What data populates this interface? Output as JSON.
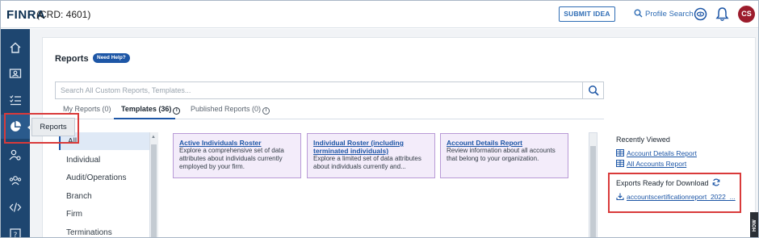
{
  "header": {
    "logo": "FINRA",
    "crd": "(CRD: 4601)",
    "submit_idea": "SUBMIT IDEA",
    "profile_search": "Profile Search",
    "avatar_initials": "CS"
  },
  "sidebar": {
    "items": [
      {
        "icon": "home-icon"
      },
      {
        "icon": "id-card-icon"
      },
      {
        "icon": "checklist-icon"
      },
      {
        "icon": "pie-chart-icon",
        "active": true
      },
      {
        "icon": "user-settings-icon"
      },
      {
        "icon": "users-icon"
      },
      {
        "icon": "code-icon"
      },
      {
        "icon": "help-icon"
      }
    ],
    "tooltip": "Reports"
  },
  "page": {
    "title": "Reports",
    "need_help": "Need Help?"
  },
  "search": {
    "placeholder": "Search All Custom Reports, Templates..."
  },
  "tabs": [
    {
      "label": "My Reports (0)"
    },
    {
      "label": "Templates (36)",
      "active": true
    },
    {
      "label": "Published Reports (0)"
    }
  ],
  "filters": [
    "All",
    "Individual",
    "Audit/Operations",
    "Branch",
    "Firm",
    "Terminations"
  ],
  "cards": [
    {
      "title": "Active Individuals Roster",
      "description": "Explore a comprehensive set of data attributes about individuals currently employed by your firm."
    },
    {
      "title": "Individual Roster (including terminated individuals)",
      "description": "Explore a limited set of data attributes about individuals currently and..."
    },
    {
      "title": "Account Details Report",
      "description": "Review information about all accounts that belong to your organization."
    }
  ],
  "recently_viewed": {
    "title": "Recently Viewed",
    "items": [
      "Account Details Report",
      "All Accounts Report"
    ]
  },
  "exports": {
    "title": "Exports Ready for Download",
    "items": [
      "accountscertificationreport_2022_..."
    ]
  },
  "how_tab": "HOW",
  "colors": {
    "brand_blue": "#1d56a6",
    "sidebar": "#1e4670",
    "highlight_red": "#d93a3a",
    "card_purple": "#f3ecfa"
  }
}
